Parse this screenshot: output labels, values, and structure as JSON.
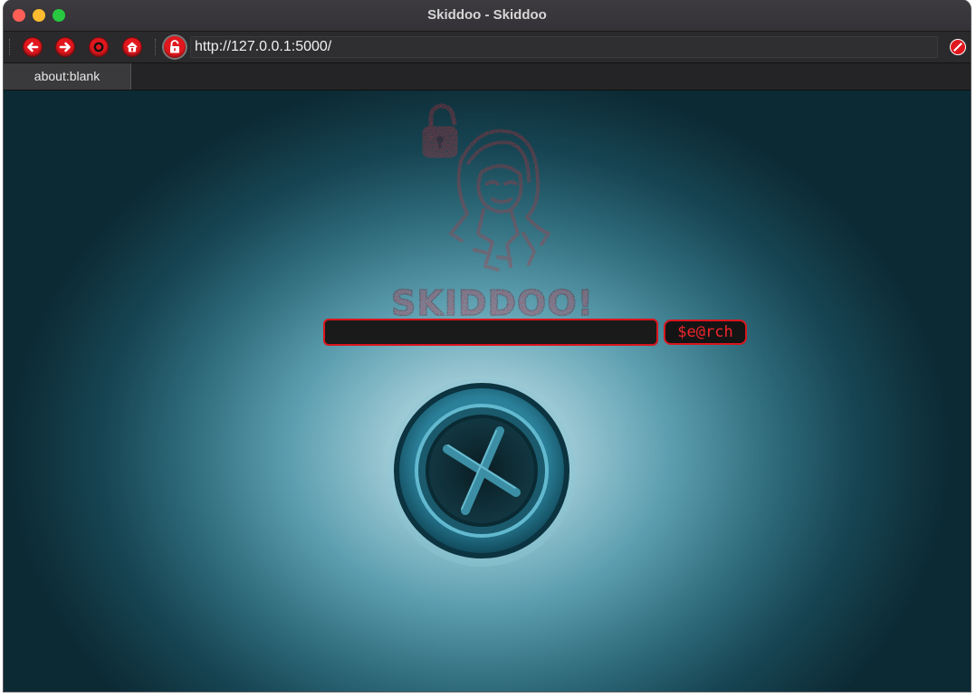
{
  "window": {
    "title": "Skiddoo - Skiddoo"
  },
  "toolbar": {
    "url": "http://127.0.0.1:5000/",
    "icons": [
      "back-arrow-icon",
      "forward-arrow-icon",
      "reload-icon",
      "home-icon",
      "lock-icon",
      "stop-icon"
    ]
  },
  "tabs": [
    {
      "label": "about:blank"
    }
  ],
  "page": {
    "logo_text": "SKIDDOO!",
    "search_placeholder": "",
    "search_button_label": "$e@rch",
    "accent_color": "#d9151d"
  }
}
